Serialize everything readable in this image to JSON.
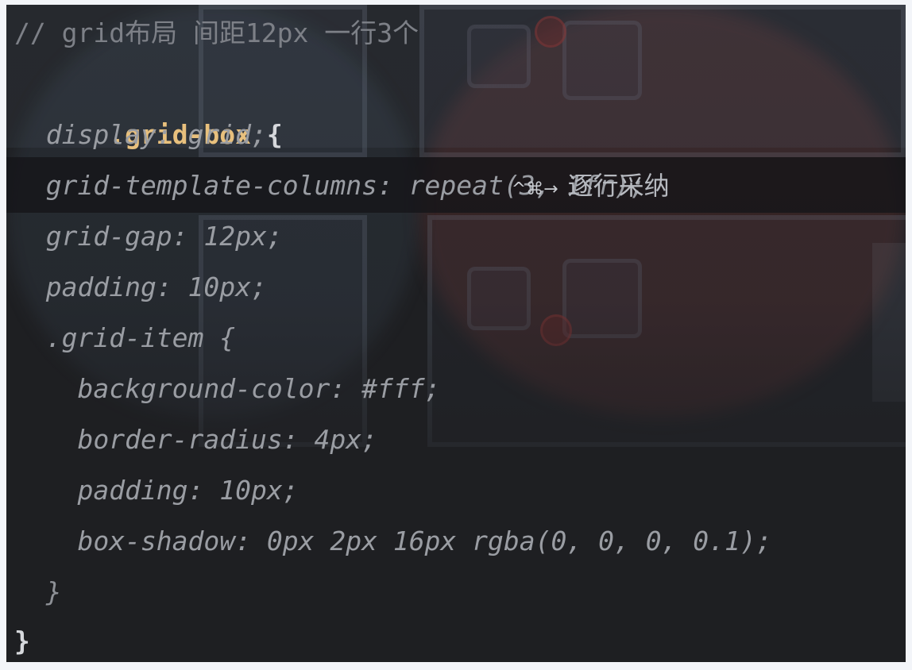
{
  "editor": {
    "comment": "// grid布局 间距12px 一行3个",
    "selector": ".grid-box",
    "open_brace": " {",
    "close_brace": "}",
    "suggestion_lines": [
      "  display: grid;",
      "  grid-template-columns: repeat(3, 1fr);",
      "  grid-gap: 12px;",
      "  padding: 10px;",
      "  .grid-item {",
      "    background-color: #fff;",
      "    border-radius: 4px;",
      "    padding: 10px;",
      "    box-shadow: 0px 2px 16px rgba(0, 0, 0, 0.1);",
      "  }"
    ],
    "hint": {
      "shortcut": "^⌘→",
      "label": "逐行采纳"
    }
  },
  "colors": {
    "background": "#1e1f22",
    "comment": "#7d8087",
    "selector": "#e8c07d",
    "ghost_text": "#9a9da3"
  }
}
